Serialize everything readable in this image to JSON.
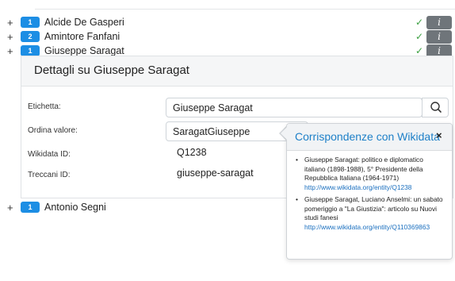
{
  "rows": [
    {
      "count": "1",
      "name": "Alcide De Gasperi"
    },
    {
      "count": "2",
      "name": "Amintore Fanfani"
    },
    {
      "count": "1",
      "name": "Giuseppe Saragat"
    },
    {
      "count": "1",
      "name": "Antonio Segni"
    }
  ],
  "row_toggle_symbol": "+",
  "check_symbol": "✓",
  "info_symbol": "i",
  "detail": {
    "title": "Dettagli su Giuseppe Saragat",
    "label_label": "Etichetta:",
    "label_value": "Giuseppe Saragat",
    "sort_label": "Ordina valore:",
    "sort_value": "SaragatGiuseppe",
    "wikidata_label": "Wikidata ID:",
    "wikidata_value": "Q1238",
    "treccani_label": "Treccani ID:",
    "treccani_value": "giuseppe-saragat"
  },
  "popover": {
    "title": "Corrispondenze con Wikidata",
    "close_symbol": "×",
    "matches": [
      {
        "text": "Giuseppe Saragat: politico e diplomatico italiano (1898-1988), 5° Presidente della Repubblica Italiana (1964-1971)",
        "url": "http://www.wikidata.org/entity/Q1238"
      },
      {
        "text": "Giuseppe Saragat, Luciano Anselmi: un sabato pomeriggio a \"La Giustizia\": articolo su Nuovi studi fanesi",
        "url": "http://www.wikidata.org/entity/Q110369863"
      }
    ]
  },
  "icons": {
    "search": "search-icon",
    "check": "check-icon",
    "info": "info-icon",
    "close": "close-icon"
  },
  "colors": {
    "badge": "#1d8ee4",
    "check": "#3ca041",
    "info_button": "#6f757a",
    "popover_title": "#1e80c8",
    "link": "#1a6fbf"
  }
}
